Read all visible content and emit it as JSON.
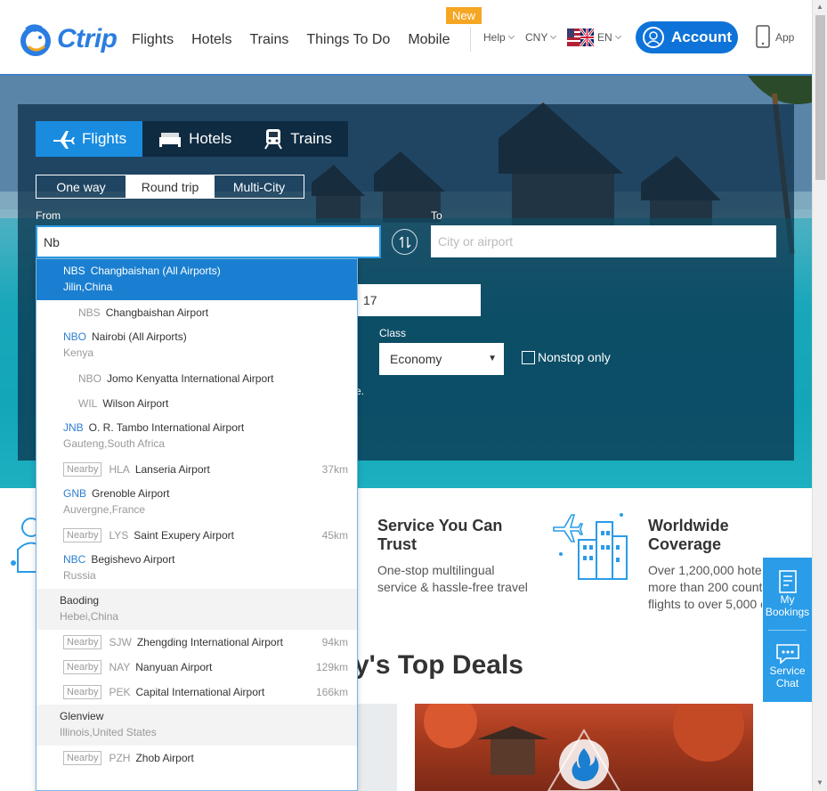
{
  "brand": {
    "name": "Ctrip"
  },
  "nav": {
    "items": [
      "Flights",
      "Hotels",
      "Trains",
      "Things To Do",
      "Mobile"
    ],
    "new_badge": "New",
    "help": "Help",
    "currency": "CNY",
    "language": "EN",
    "account": "Account",
    "app": "App"
  },
  "search": {
    "tabs": [
      "Flights",
      "Hotels",
      "Trains"
    ],
    "trip_types": [
      "One way",
      "Round trip",
      "Multi-City"
    ],
    "selected_trip_type": "Round trip",
    "from_label": "From",
    "from_value": "Nb",
    "to_label": "To",
    "to_placeholder": "City or airport",
    "date_fragment": "17",
    "class_label": "Class",
    "class_value": "Economy",
    "nonstop_label": "Nonstop only",
    "hidden_fragment": "e."
  },
  "dropdown": {
    "rows": [
      {
        "kind": "city",
        "code": "NBS",
        "name": "Changbaishan (All Airports)",
        "location": "Jilin,China",
        "highlighted": true
      },
      {
        "kind": "sub",
        "code": "NBS",
        "name": "Changbaishan Airport"
      },
      {
        "kind": "city",
        "code": "NBO",
        "name": "Nairobi (All Airports)",
        "location": "Kenya"
      },
      {
        "kind": "sub",
        "code": "NBO",
        "name": "Jomo Kenyatta International Airport"
      },
      {
        "kind": "sub",
        "code": "WIL",
        "name": "Wilson Airport"
      },
      {
        "kind": "city",
        "code": "JNB",
        "name": "O. R. Tambo International Airport",
        "location": "Gauteng,South Africa"
      },
      {
        "kind": "nearby",
        "tag": "Nearby",
        "code": "HLA",
        "name": "Lanseria Airport",
        "distance": "37km"
      },
      {
        "kind": "city",
        "code": "GNB",
        "name": "Grenoble Airport",
        "location": "Auvergne,France"
      },
      {
        "kind": "nearby",
        "tag": "Nearby",
        "code": "LYS",
        "name": "Saint Exupery Airport",
        "distance": "45km"
      },
      {
        "kind": "city",
        "code": "NBC",
        "name": "Begishevo Airport",
        "location": "Russia"
      },
      {
        "kind": "group",
        "name": "Baoding",
        "location": "Hebei,China"
      },
      {
        "kind": "nearby",
        "tag": "Nearby",
        "code": "SJW",
        "name": "Zhengding International Airport",
        "distance": "94km"
      },
      {
        "kind": "nearby",
        "tag": "Nearby",
        "code": "NAY",
        "name": "Nanyuan Airport",
        "distance": "129km"
      },
      {
        "kind": "nearby",
        "tag": "Nearby",
        "code": "PEK",
        "name": "Capital International Airport",
        "distance": "166km"
      },
      {
        "kind": "group",
        "name": "Glenview",
        "location": "Illinois,United States"
      },
      {
        "kind": "nearby",
        "tag": "Nearby",
        "code": "PZH",
        "name": "Zhob Airport",
        "distance": ""
      }
    ]
  },
  "features": [
    {
      "title_line1": "Service You Can",
      "title_line2": "Trust",
      "text_line1": "One-stop multilingual",
      "text_line2": "service & hassle-free travel"
    },
    {
      "title_line1": "Worldwide",
      "title_line2": "Coverage",
      "text_line1": "Over 1,200,000 hote",
      "text_line2": "more than 200 count",
      "text_line3": "flights to over 5,000 c"
    }
  ],
  "deals": {
    "title_fragment": "y's Top Deals"
  },
  "side_panel": {
    "bookings": "My Bookings",
    "bookings_line1": "My",
    "bookings_line2": "Bookings",
    "chat_line1": "Service",
    "chat_line2": "Chat"
  },
  "colors": {
    "brand_blue": "#0e73d8",
    "accent_blue": "#1a8ce0",
    "new_badge": "#f5a623",
    "highlight": "#1a7fd0"
  }
}
